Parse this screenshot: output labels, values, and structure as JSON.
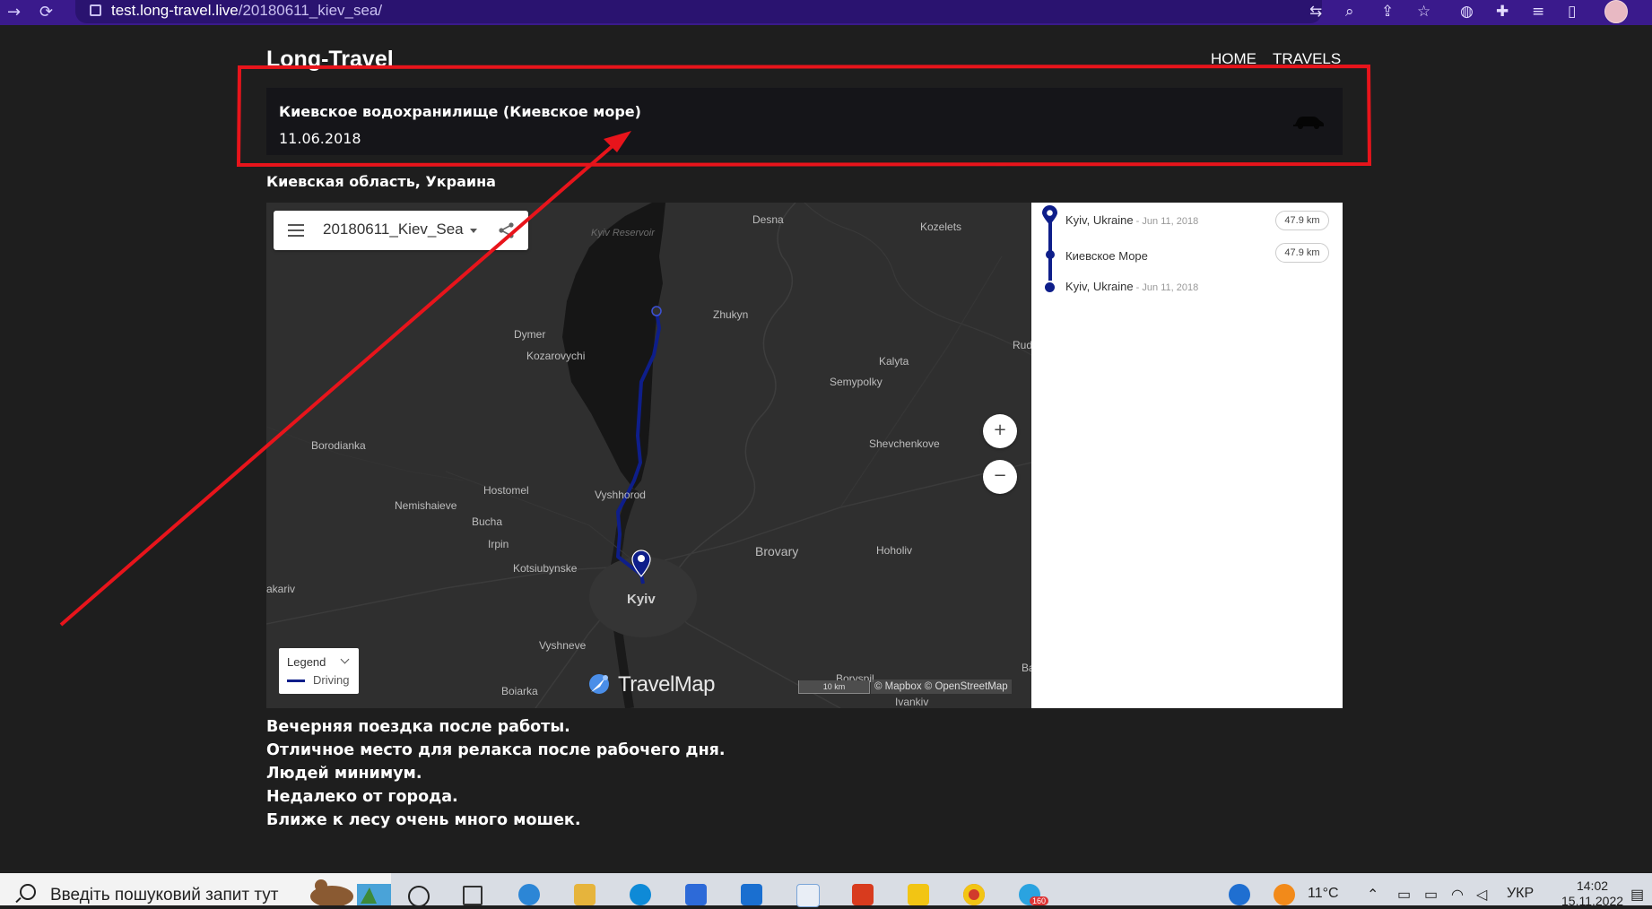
{
  "browser": {
    "url_host": "test.long-travel.live",
    "url_path": "/20180611_kiev_sea/"
  },
  "site": {
    "title": "Long-Travel",
    "nav": [
      "HOME",
      "TRAVELS"
    ]
  },
  "trip": {
    "name": "Киевское водохранилище (Киевское море)",
    "date": "11.06.2018",
    "region": "Киевская область, Украина"
  },
  "map": {
    "toolbar_title": "20180611_Kiev_Sea",
    "zoom_in": "+",
    "zoom_out": "−",
    "legend": {
      "title": "Legend",
      "items": [
        {
          "label": "Driving",
          "color": "#0e1e8a"
        }
      ]
    },
    "brand": "TravelMap",
    "scale_label": "10 km",
    "attribution": "© Mapbox © OpenStreetMap",
    "places": {
      "desna": "Desna",
      "kozelets": "Kozelets",
      "kyiv_reservoir": "Kyiv Reservoir",
      "zhukyn": "Zhukyn",
      "dymer": "Dymer",
      "kozarovychi": "Kozarovychi",
      "kalyta": "Kalyta",
      "semypolky": "Semypolky",
      "rud": "Rud",
      "borodianka": "Borodianka",
      "shevchenkove": "Shevchenkove",
      "hostomel": "Hostomel",
      "vyshhorod": "Vyshhorod",
      "nemishaieve": "Nemishaieve",
      "bucha": "Bucha",
      "irpin": "Irpin",
      "brovary": "Brovary",
      "hoholiv": "Hoholiv",
      "kotsiubynske": "Kotsiubynske",
      "makariv": "akariv",
      "kyiv": "Kyiv",
      "vyshneve": "Vyshneve",
      "boryspil": "Boryspil",
      "boiarka": "Boiarka",
      "ivankiv": "Ivankiv",
      "ba": "Ba"
    },
    "route_color": "#0e1e8a"
  },
  "stops": [
    {
      "name": "Kyiv, Ukraine",
      "date": " - Jun 11, 2018",
      "distance": "47.9 km"
    },
    {
      "name": "Киевское Море",
      "date": "",
      "distance": "47.9 km"
    },
    {
      "name": "Kyiv, Ukraine",
      "date": " - Jun 11, 2018",
      "distance": ""
    }
  ],
  "description": [
    "Вечерняя поездка после работы.",
    "Отличное место для релакса после рабочего дня.",
    "Людей минимум.",
    "Недалеко от города.",
    "Ближе к лесу очень много мошек."
  ],
  "annotation": {
    "color": "#e8141b"
  },
  "taskbar": {
    "search_placeholder": "Введіть пошуковий запит тут",
    "weather": "11°C",
    "language": "УКР",
    "time": "14:02",
    "date": "15.11.2022",
    "telegram_badge": "160"
  }
}
